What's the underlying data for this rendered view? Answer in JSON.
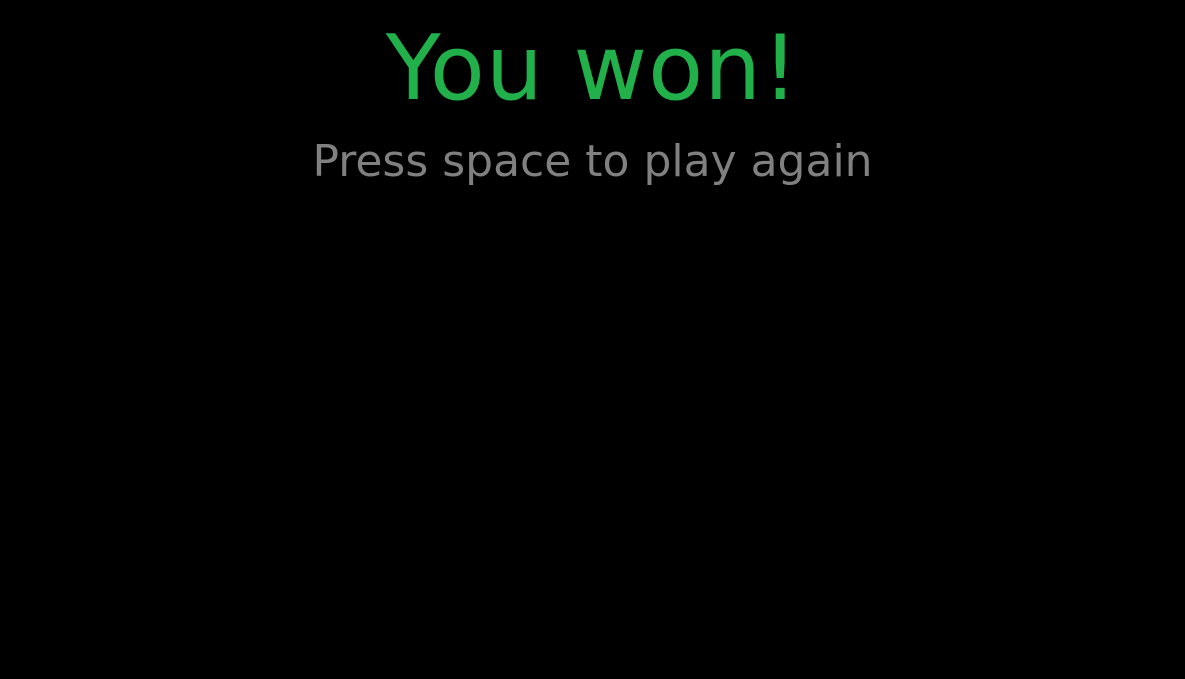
{
  "game_over": {
    "title": "You won!",
    "prompt": "Press space to play again"
  },
  "colors": {
    "background": "#000000",
    "title": "#22b04b",
    "prompt": "#808080"
  }
}
